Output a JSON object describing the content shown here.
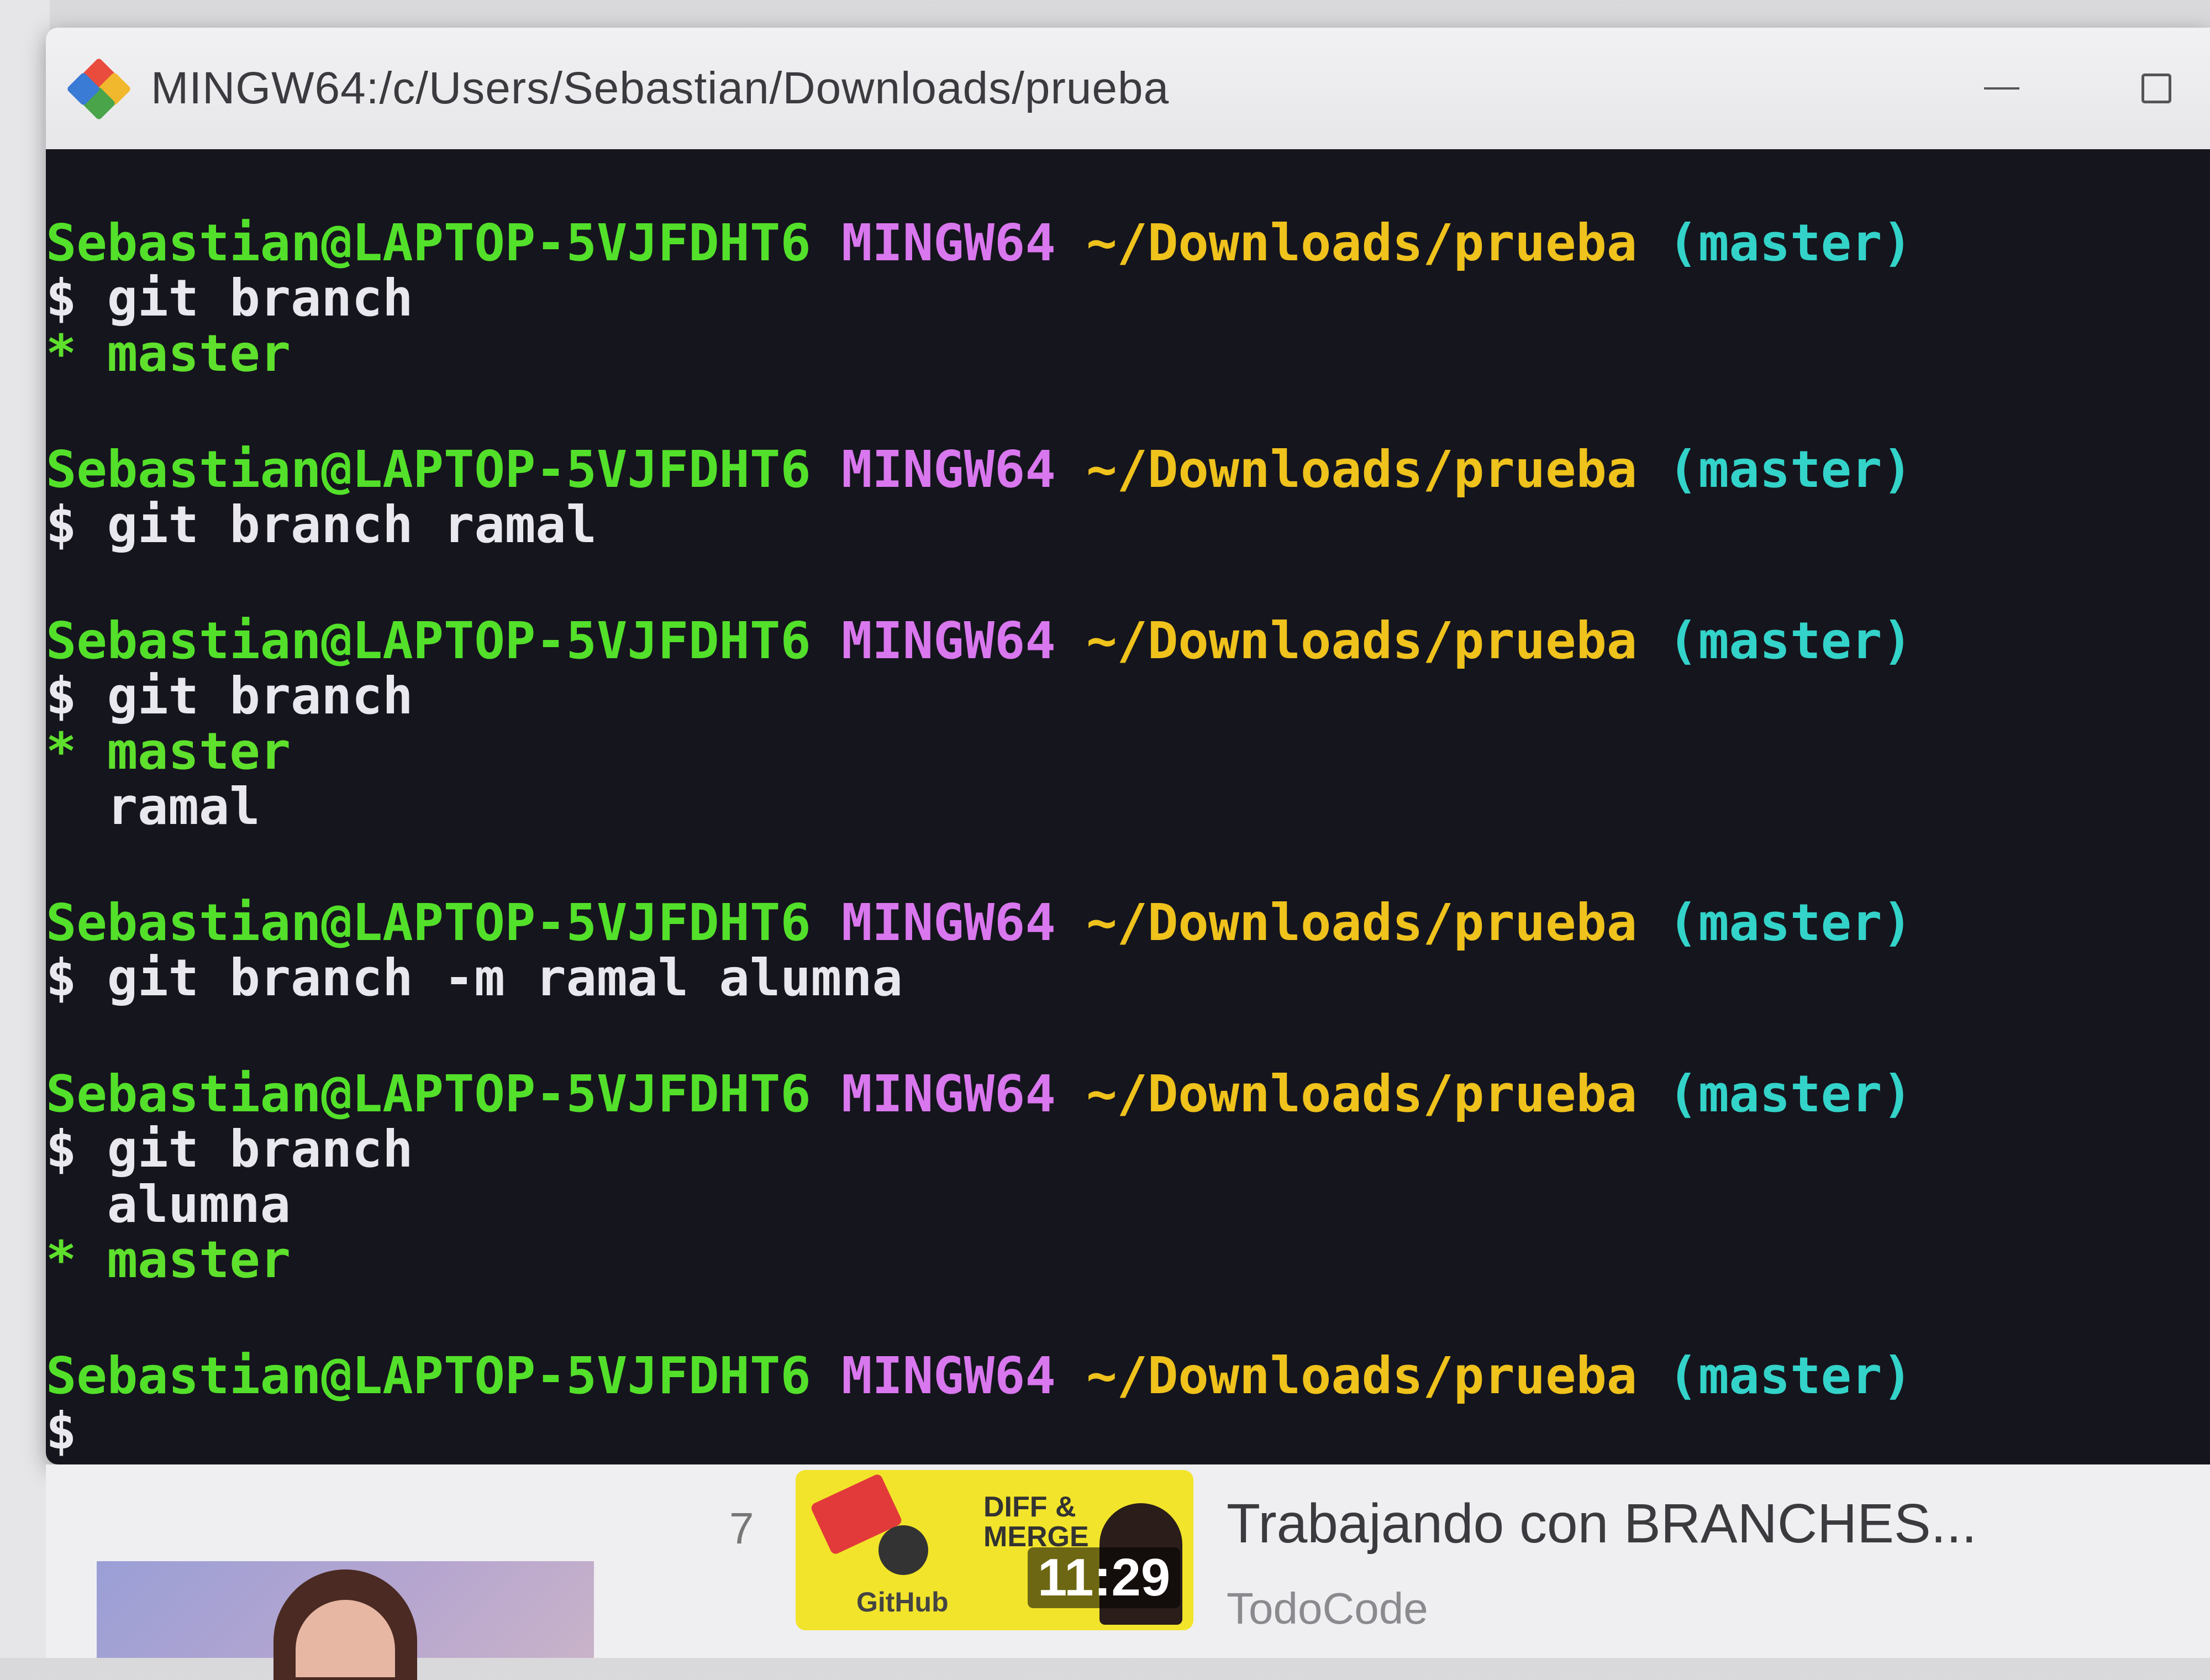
{
  "window": {
    "title": "MINGW64:/c/Users/Sebastian/Downloads/prueba",
    "icon": "git-bash-icon",
    "controls": [
      "minimize-icon",
      "maximize-icon"
    ]
  },
  "prompt": {
    "user": "Sebastian@LAPTOP-5VJFDHT6",
    "system": "MINGW64",
    "path": "~/Downloads/prueba",
    "branch": "(master)"
  },
  "blocks": [
    {
      "command": "$ git branch",
      "output": [
        {
          "text": "* master",
          "current": true
        }
      ]
    },
    {
      "command": "$ git branch ramal",
      "output": []
    },
    {
      "command": "$ git branch",
      "output": [
        {
          "text": "* master",
          "current": true
        },
        {
          "text": "  ramal",
          "current": false
        }
      ]
    },
    {
      "command": "$ git branch -m ramal alumna",
      "output": []
    },
    {
      "command": "$ git branch",
      "output": [
        {
          "text": "  alumna",
          "current": false
        },
        {
          "text": "* master",
          "current": true
        }
      ]
    }
  ],
  "final_prompt_cursor": "$",
  "colors": {
    "user": "#53e02a",
    "system": "#d977ee",
    "path": "#efc21c",
    "branch": "#33d3c9",
    "terminal_bg": "#15151d"
  },
  "video": {
    "index": "7",
    "thumb_badge": "DIFF & MERGE",
    "thumb_logo": "GitHub",
    "duration": "11:29",
    "title": "Trabajando con BRANCHES...",
    "channel": "TodoCode"
  }
}
